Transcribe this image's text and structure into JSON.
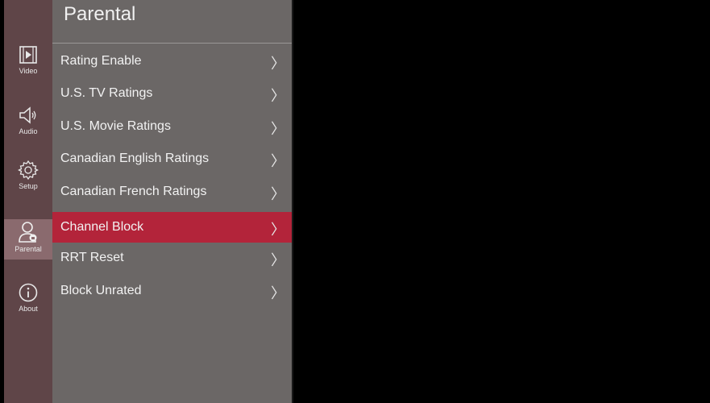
{
  "rail": {
    "items": [
      {
        "label": "Video",
        "icon": "video-icon"
      },
      {
        "label": "Audio",
        "icon": "audio-icon"
      },
      {
        "label": "Setup",
        "icon": "gear-icon"
      },
      {
        "label": "Parental",
        "icon": "user-lock-icon"
      },
      {
        "label": "About",
        "icon": "info-icon"
      }
    ],
    "active_index": 3
  },
  "menu": {
    "title": "Parental",
    "chevron": "〉",
    "items": [
      {
        "label": "Rating Enable"
      },
      {
        "label": "U.S. TV Ratings"
      },
      {
        "label": "U.S. Movie Ratings"
      },
      {
        "label": "Canadian English Ratings"
      },
      {
        "label": "Canadian French Ratings"
      },
      {
        "label": "Channel Block"
      },
      {
        "label": "RRT Reset"
      },
      {
        "label": "Block Unrated"
      }
    ],
    "selected_index": 5
  },
  "colors": {
    "rail_bg": "#5f4548",
    "rail_active": "#8a6a6e",
    "panel_bg": "#6b6766",
    "selected_bg": "#b3243a",
    "screen_bg": "#000000"
  }
}
